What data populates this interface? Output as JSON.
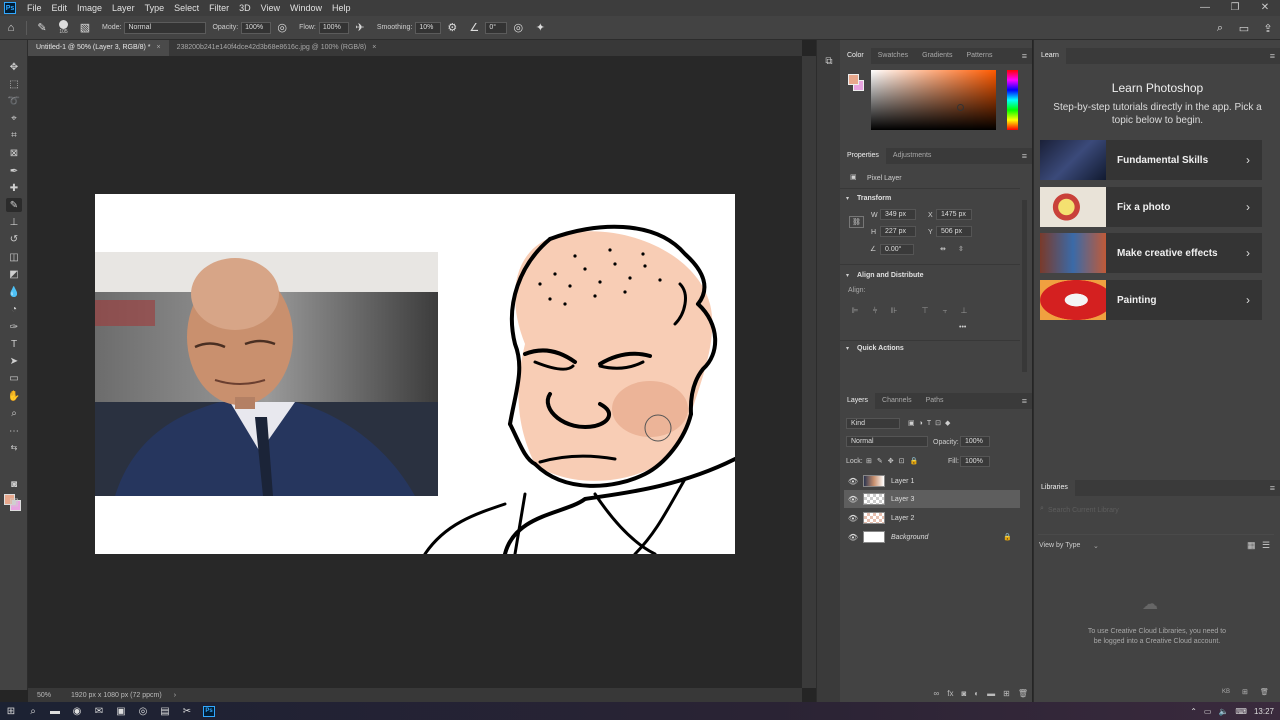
{
  "app": {
    "logo": "Ps",
    "menu": [
      "File",
      "Edit",
      "Image",
      "Layer",
      "Type",
      "Select",
      "Filter",
      "3D",
      "View",
      "Window",
      "Help"
    ],
    "window_controls": [
      "—",
      "❐",
      "✕"
    ]
  },
  "options_bar": {
    "brush_size": "105",
    "mode_label": "Mode:",
    "mode_value": "Normal",
    "opacity_label": "Opacity:",
    "opacity_value": "100%",
    "flow_label": "Flow:",
    "flow_value": "100%",
    "smoothing_label": "Smoothing:",
    "smoothing_value": "10%",
    "angle_value": "0°"
  },
  "tabs": [
    {
      "label": "Untitled-1 @ 50% (Layer 3, RGB/8) *",
      "active": true
    },
    {
      "label": "238200b241e140f4dce42d3b68e8616c.jpg @ 100% (RGB/8)",
      "active": false
    }
  ],
  "status_bar": {
    "zoom": "50%",
    "doc_info": "1920 px x 1080 px (72 ppcm)"
  },
  "color_panel": {
    "tabs": [
      "Color",
      "Swatches",
      "Gradients",
      "Patterns"
    ],
    "foreground": "#e8a88d",
    "background": "#e8a3e0"
  },
  "properties": {
    "tabs": [
      "Properties",
      "Adjustments"
    ],
    "layer_type": "Pixel Layer",
    "transform_label": "Transform",
    "w_label": "W",
    "w": "349 px",
    "x_label": "X",
    "x": "1475 px",
    "h_label": "H",
    "h": "227 px",
    "y_label": "Y",
    "y": "506 px",
    "angle": "0.00°",
    "align_section": "Align and Distribute",
    "align_label": "Align:",
    "quick_actions": "Quick Actions"
  },
  "layers": {
    "tabs": [
      "Layers",
      "Channels",
      "Paths"
    ],
    "kind": "Kind",
    "blend_mode": "Normal",
    "opacity_label": "Opacity:",
    "opacity": "100%",
    "lock_label": "Lock:",
    "fill_label": "Fill:",
    "fill": "100%",
    "items": [
      {
        "name": "Layer 1",
        "selected": false
      },
      {
        "name": "Layer 3",
        "selected": true
      },
      {
        "name": "Layer 2",
        "selected": false
      },
      {
        "name": "Background",
        "selected": false
      }
    ]
  },
  "learn": {
    "tab": "Learn",
    "title": "Learn Photoshop",
    "description": "Step-by-step tutorials directly in the app. Pick a topic below to begin.",
    "cards": [
      {
        "label": "Fundamental Skills"
      },
      {
        "label": "Fix a photo"
      },
      {
        "label": "Make creative effects"
      },
      {
        "label": "Painting"
      }
    ]
  },
  "libraries": {
    "tab": "Libraries",
    "search_placeholder": "Search Current Library",
    "view_by": "View by Type",
    "info": "To use Creative Cloud Libraries, you need to be logged into a Creative Cloud account.",
    "kb": "KB"
  },
  "taskbar": {
    "ps": "Ps",
    "time": "13:27"
  },
  "colors": {
    "accent": "#31a8ff",
    "panel": "#434343",
    "workspace": "#282828"
  }
}
